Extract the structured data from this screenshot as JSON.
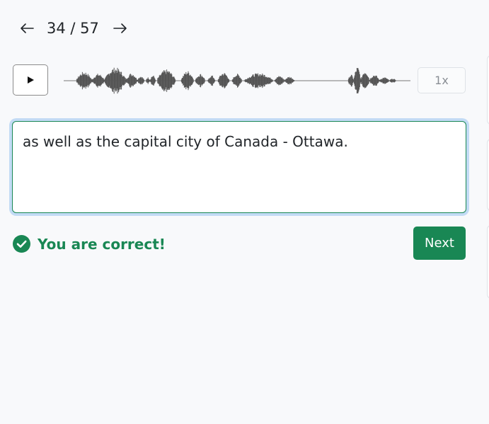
{
  "navigation": {
    "prev_icon": "arrow-left-icon",
    "counter": "34 / 57",
    "next_icon": "arrow-right-icon"
  },
  "player": {
    "play_icon": "play-icon",
    "speed_label": "1x"
  },
  "answer": {
    "text": "as well as the capital city of Canada - Ottawa."
  },
  "result": {
    "icon": "check-circle-icon",
    "message": "You are correct!",
    "color": "#198754"
  },
  "actions": {
    "next_label": "Next"
  },
  "colors": {
    "accent": "#198754",
    "waveform": "#555555",
    "focus_ring": "#c3dbf5"
  }
}
